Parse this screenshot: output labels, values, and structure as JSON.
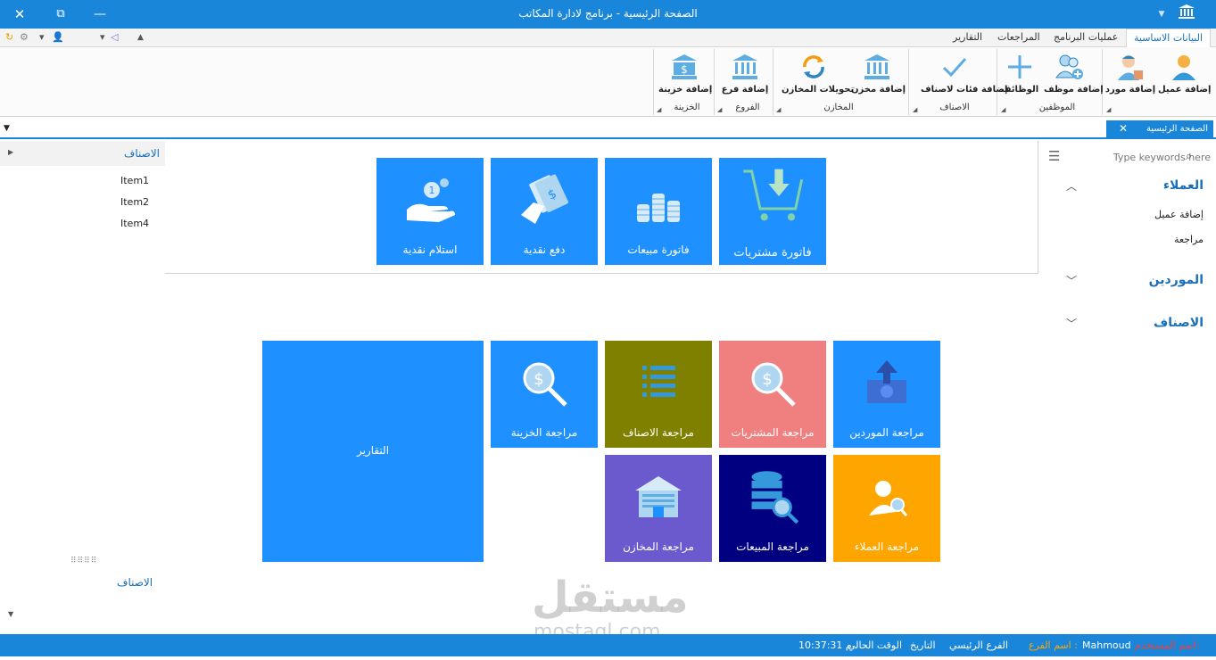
{
  "window": {
    "title": "الصفحة الرئيسية - برنامج لادارة المكاتب",
    "close_glyph": "✕",
    "max_glyph": "⧉",
    "min_glyph": "—",
    "dropdown_glyph": "▼"
  },
  "qat": {
    "glyphs": [
      "↻",
      "⚙",
      "▾",
      "👤",
      "▾",
      "◁",
      "▲"
    ]
  },
  "ribbon_tabs": [
    "البيانات الاساسية",
    "عمليات البرنامج",
    "المراجعات",
    "التقارير"
  ],
  "ribbon": {
    "buttons": [
      {
        "label": "إضافة عميل",
        "icon": "customer-icon"
      },
      {
        "label": "إضافة مورد",
        "icon": "supplier-icon"
      },
      {
        "label": "إضافة موظف",
        "icon": "add-employee-icon"
      },
      {
        "label": "الوظائف",
        "icon": "plus-icon"
      },
      {
        "label": "إضافة فئات لاصناف",
        "icon": "checkmark-icon"
      },
      {
        "label": "إضافة مخزن",
        "icon": "bank-icon"
      },
      {
        "label": "تحويلات المخازن",
        "icon": "refresh-icon"
      },
      {
        "label": "إضافة فرع",
        "icon": "bank-icon"
      },
      {
        "label": "إضافة خزينة",
        "icon": "bank-dollar-icon"
      }
    ],
    "groups": [
      "الموظفين",
      "الاصناف",
      "المخازن",
      "الفروع",
      "الخزينة"
    ]
  },
  "doc_tab": {
    "label": "الصفحة الرئيسية",
    "close": "✕"
  },
  "left_nav": {
    "header": "الاصناف",
    "items": [
      "Item1",
      "Item2",
      "Item4"
    ],
    "footer": "الاصناف",
    "grip": "⠿⠿⠿⠿"
  },
  "right_nav": {
    "search_placeholder": "Type keywords here",
    "groups": [
      {
        "title": "العملاء",
        "expanded": true,
        "items": [
          "إضافة عميل",
          "مراجعة"
        ]
      },
      {
        "title": "الموردين",
        "expanded": false,
        "items": []
      },
      {
        "title": "الاصناف",
        "expanded": false,
        "items": []
      }
    ]
  },
  "tiles_top": [
    {
      "label": "فاتورة مشتريات",
      "color": "#1e90ff",
      "icon": "cart-icon"
    },
    {
      "label": "فاتورة مبيعات",
      "color": "#1e90ff",
      "icon": "coins-icon"
    },
    {
      "label": "دفع نقدية",
      "color": "#1e90ff",
      "icon": "pay-cash-icon"
    },
    {
      "label": "استلام نقدية",
      "color": "#1e90ff",
      "icon": "receive-cash-icon"
    }
  ],
  "tiles_bottom": [
    {
      "label": "مراجعة الموردين",
      "color": "#1e90ff",
      "icon": "money-upload-icon"
    },
    {
      "label": "مراجعة المشتريات",
      "color": "#f08080",
      "icon": "dollar-search-icon"
    },
    {
      "label": "مراجعة الاصناف",
      "color": "#808000",
      "icon": "list-icon"
    },
    {
      "label": "مراجعة الخزينة",
      "color": "#1e90ff",
      "icon": "dollar-search-icon"
    },
    {
      "label": "التقارير",
      "color": "#1e90ff",
      "icon": ""
    },
    {
      "label": "مراجعة العملاء",
      "color": "#ffa500",
      "icon": "user-search-icon"
    },
    {
      "label": "مراجعة المبيعات",
      "color": "#000080",
      "icon": "database-search-icon"
    },
    {
      "label": "مراجعة المخازن",
      "color": "#6a5acd",
      "icon": "warehouse-icon"
    }
  ],
  "status": {
    "user_label": "اسم المستخدم:",
    "user_value": "Mahmoud",
    "branch_label": "اسم الفرع :",
    "branch_value": "الفرع الرئيسي",
    "date_label": "التاريخ",
    "time_label": "الوقت الحالي",
    "time_value": "10:37:31 م"
  },
  "watermark": {
    "ar": "مستقل",
    "en": "mostaql.com"
  }
}
